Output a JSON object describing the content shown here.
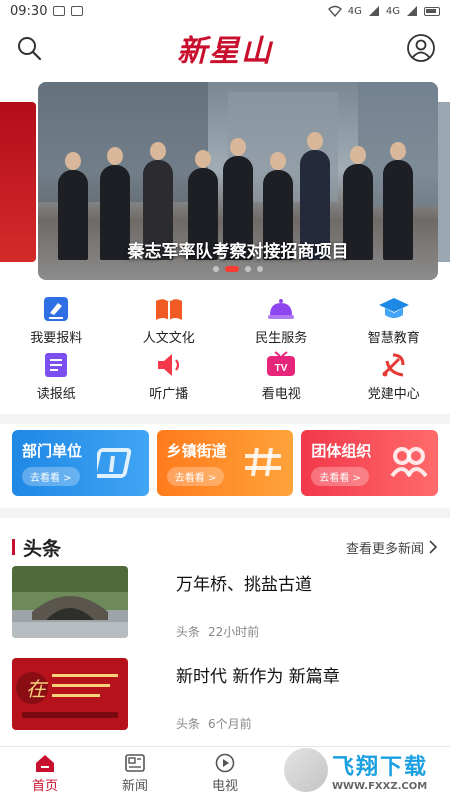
{
  "status_bar": {
    "time": "09:30",
    "net1": "4G",
    "net2": "4G"
  },
  "header": {
    "logo": "新星山"
  },
  "banner": {
    "caption": "秦志军率队考察对接招商项目",
    "slide_count": 4,
    "active_slide": 2
  },
  "grid": [
    {
      "label": "我要报料",
      "icon": "report-icon",
      "color": "#2f6fe4"
    },
    {
      "label": "人文文化",
      "icon": "book-icon",
      "color": "#f05a24"
    },
    {
      "label": "民生服务",
      "icon": "service-bell-icon",
      "color": "#8e44ef"
    },
    {
      "label": "智慧教育",
      "icon": "graduation-cap-icon",
      "color": "#1e88e5"
    },
    {
      "label": "读报纸",
      "icon": "newspaper-icon",
      "color": "#7b4ff0"
    },
    {
      "label": "听广播",
      "icon": "broadcast-icon",
      "color": "#f2384a"
    },
    {
      "label": "看电视",
      "icon": "tv-icon",
      "color": "#e6257a"
    },
    {
      "label": "党建中心",
      "icon": "party-emblem-icon",
      "color": "#e53935"
    }
  ],
  "cards": [
    {
      "title": "部门单位",
      "button": "去看看 >",
      "color": "#1e88e5"
    },
    {
      "title": "乡镇街道",
      "button": "去看看 >",
      "color": "#ff7b1c"
    },
    {
      "title": "团体组织",
      "button": "去看看 >",
      "color": "#f2384a"
    }
  ],
  "section": {
    "title": "头条",
    "more": "查看更多新闻"
  },
  "news": [
    {
      "headline": "万年桥、挑盐古道",
      "tag": "头条",
      "time": "22小时前"
    },
    {
      "headline": "新时代 新作为 新篇章",
      "tag": "头条",
      "time": "6个月前"
    }
  ],
  "tabbar": [
    {
      "label": "首页",
      "icon": "home-icon",
      "active": true
    },
    {
      "label": "新闻",
      "icon": "news-icon",
      "active": false
    },
    {
      "label": "电视",
      "icon": "play-icon",
      "active": false
    }
  ],
  "watermark": {
    "title": "飞翔下载",
    "url": "WWW.FXXZ.COM"
  },
  "colors": {
    "brand_red": "#c8102e",
    "tab_active": "#c8102e"
  }
}
